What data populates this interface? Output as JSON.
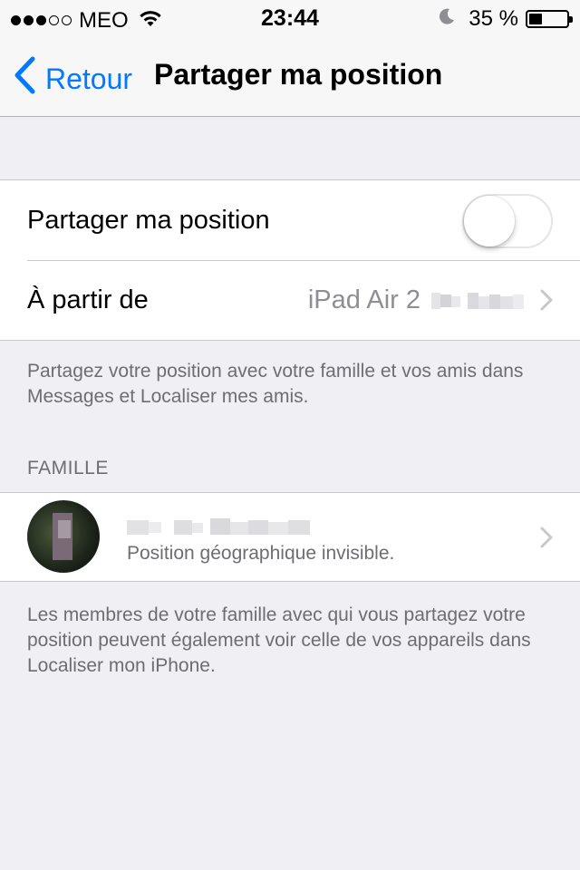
{
  "status_bar": {
    "signal_icon": "signal-dots-icon",
    "signal_bars_filled": 3,
    "signal_bars_total": 5,
    "carrier": "MEO",
    "wifi_icon": "wifi-icon",
    "time": "23:44",
    "moon_icon": "do-not-disturb-moon-icon",
    "battery_text": "35 %",
    "battery_level": 0.35,
    "battery_icon": "battery-icon"
  },
  "nav": {
    "back_label": "Retour",
    "back_icon": "chevron-left-icon",
    "title": "Partager ma position",
    "accent_color": "#007aff"
  },
  "settings": {
    "share_label": "Partager ma position",
    "share_enabled": false,
    "from_label": "À partir de",
    "from_value": "iPad Air 2",
    "from_chevron_icon": "chevron-right-icon"
  },
  "share_footer": "Partagez votre position avec votre famille et vos amis dans Messages et Localiser mes amis.",
  "family": {
    "header": "FAMILLE",
    "members": [
      {
        "avatar_icon": "avatar",
        "status": "Position géographique invisible.",
        "chevron_icon": "chevron-right-icon"
      }
    ],
    "footer": "Les membres de votre famille avec qui vous partagez votre position peuvent également voir celle de vos appareils dans Localiser mon iPhone."
  }
}
